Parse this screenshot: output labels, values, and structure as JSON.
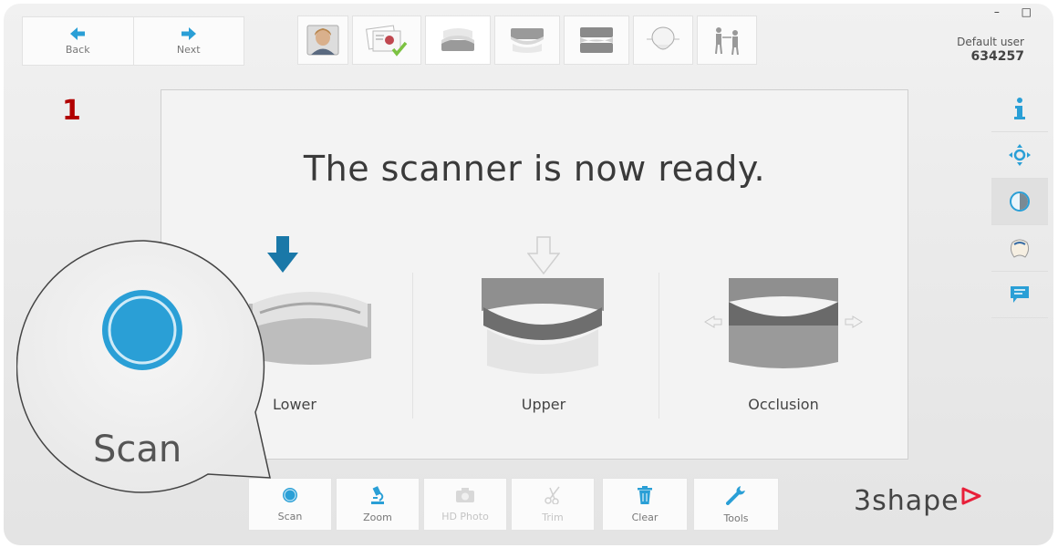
{
  "window": {
    "controls": "– □"
  },
  "nav": {
    "back_label": "Back",
    "next_label": "Next"
  },
  "steps": [
    {
      "name": "patient"
    },
    {
      "name": "order-form",
      "completed": true
    },
    {
      "name": "lower-scan"
    },
    {
      "name": "upper-scan"
    },
    {
      "name": "occlusion-scan"
    },
    {
      "name": "post-processing"
    },
    {
      "name": "send"
    }
  ],
  "user": {
    "name": "Default user",
    "id": "634257"
  },
  "annotation": {
    "step_number": "1"
  },
  "main": {
    "title": "The scanner is now ready.",
    "options": [
      {
        "label": "Lower",
        "visible_label": "ower",
        "active": true
      },
      {
        "label": "Upper",
        "active": false
      },
      {
        "label": "Occlusion",
        "active": false
      }
    ]
  },
  "sidebar": {
    "items": [
      {
        "icon": "info-icon"
      },
      {
        "icon": "move-icon"
      },
      {
        "icon": "shade-icon",
        "active": true
      },
      {
        "icon": "texture-icon"
      },
      {
        "icon": "comment-icon"
      }
    ]
  },
  "toolbar": {
    "scan_label": "Scan",
    "zoom_label": "Zoom",
    "hdphoto_label": "HD Photo",
    "trim_label": "Trim",
    "clear_label": "Clear",
    "tools_label": "Tools"
  },
  "callout": {
    "label": "Scan"
  },
  "brand": {
    "logo": "3shape",
    "accent": "#e8203a"
  },
  "colors": {
    "primary_blue": "#2a9fd6",
    "arrow_blue": "#1a78a8"
  }
}
